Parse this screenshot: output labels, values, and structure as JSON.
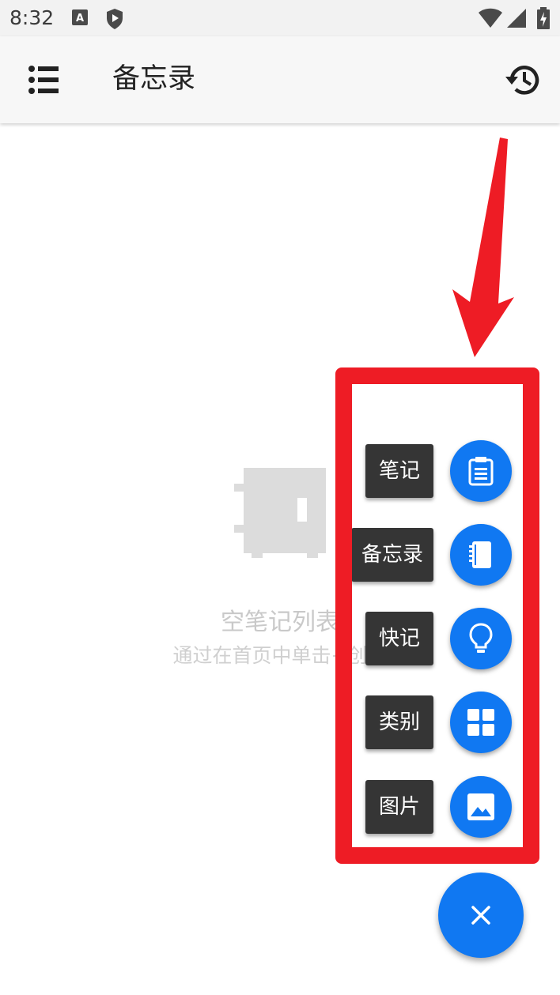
{
  "status_bar": {
    "time": "8:32",
    "icons": [
      "keyboard-a-icon",
      "shield-play-icon",
      "wifi-icon",
      "signal-icon",
      "battery-charging-icon"
    ]
  },
  "app_bar": {
    "title": "备忘录",
    "menu_icon": "menu-list-icon",
    "history_icon": "history-icon"
  },
  "empty_state": {
    "icon": "safe-box-icon",
    "title": "空笔记列表",
    "subtitle": "通过在首页中单击+创建"
  },
  "fab_menu": {
    "items": [
      {
        "label": "笔记",
        "icon": "clipboard-icon"
      },
      {
        "label": "备忘录",
        "icon": "notebook-icon"
      },
      {
        "label": "快记",
        "icon": "lightbulb-icon"
      },
      {
        "label": "类别",
        "icon": "grid-icon"
      },
      {
        "label": "图片",
        "icon": "image-icon"
      }
    ],
    "main_icon": "close-icon"
  },
  "colors": {
    "accent": "#1078f2",
    "label_bg": "#353535",
    "annotation_red": "#ee1c25",
    "empty_text": "#c9c9c9"
  }
}
